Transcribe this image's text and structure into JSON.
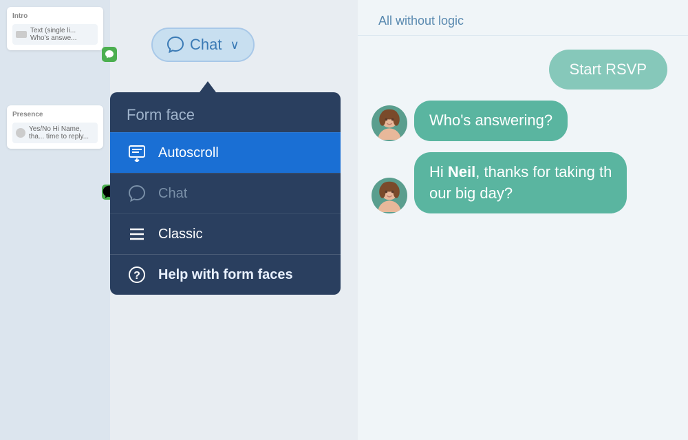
{
  "chatTrigger": {
    "label": "Chat",
    "chevron": "∨"
  },
  "dropdown": {
    "title": "Form face",
    "items": [
      {
        "id": "autoscroll",
        "label": "Autoscroll",
        "icon": "autoscroll-icon",
        "active": true,
        "dimmed": false
      },
      {
        "id": "chat",
        "label": "Chat",
        "icon": "chat-icon",
        "active": false,
        "dimmed": true
      },
      {
        "id": "classic",
        "label": "Classic",
        "icon": "classic-icon",
        "active": false,
        "dimmed": false
      },
      {
        "id": "help",
        "label": "Help with form faces",
        "icon": "help-icon",
        "active": false,
        "dimmed": false
      }
    ]
  },
  "chatArea": {
    "header": "All without logic",
    "startRsvpLabel": "Start RSVP",
    "messages": [
      {
        "text": "Who's answering?",
        "hasAvatar": true
      },
      {
        "textHtml": "Hi <b>Neil</b>, thanks for taking th<br>our big day?",
        "hasAvatar": true
      }
    ]
  },
  "leftCards": [
    {
      "title": "Intro",
      "rowText": "Text (single li... Who's answe..."
    },
    {
      "title": "Presence",
      "rowText": "Yes/No Hi Name, tha... time to reply..."
    }
  ]
}
